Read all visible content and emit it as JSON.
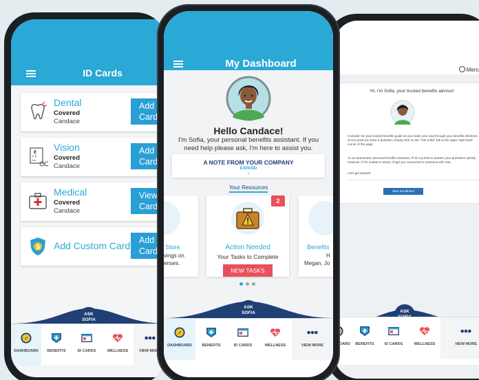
{
  "left_phone": {
    "title": "ID Cards",
    "cards": [
      {
        "title": "Dental",
        "status": "Covered",
        "name": "Candace",
        "button": [
          "Add",
          "Card"
        ],
        "icon": "tooth-icon"
      },
      {
        "title": "Vision",
        "status": "Covered",
        "name": "Candace",
        "button": [
          "Add",
          "Card"
        ],
        "icon": "eye-chart-icon"
      },
      {
        "title": "Medical",
        "status": "Covered",
        "name": "Candace",
        "button": [
          "View",
          "Card"
        ],
        "icon": "medical-kit-icon"
      },
      {
        "title": "Add Custom Card",
        "button": [
          "Add",
          "Card"
        ],
        "icon": "shield-dollar-icon"
      }
    ]
  },
  "center_phone": {
    "title": "My Dashboard",
    "greeting": "Hello Candace!",
    "intro": "I'm Sofia, your personal benefits assistant. If you need help please ask, I'm here to assist you.",
    "note_title": "A NOTE FROM YOUR COMPANY",
    "note_expand": "EXPAND",
    "resources_label": "Your Resources",
    "left_card": {
      "title": "Store",
      "line1": "vings on",
      "line2": "enses."
    },
    "main_card": {
      "badge": "2",
      "title": "Action Needed",
      "subtitle": "Your Tasks to Complete",
      "button": "NEW TASKS"
    },
    "right_card": {
      "title": "Benefits",
      "line1": "H",
      "line2": "Megan, Jo"
    }
  },
  "right_phone": {
    "menu": "Menu",
    "heading": "Hi, I'm Sofia, your trusted benefits advisor!",
    "para1": "Consider me your trusted benefits guide as you make your way through your benefits elections. If at any point you have a question, simply click on the \"Ask Sofia\" link in the upper right hand corner of the page.",
    "para2": "As an automated, personal benefits assistant, I'll do my best to answer your questions quickly. However, if I'm unable to assist, I'll get you connected to someone who can.",
    "para3": "Let's get started!",
    "button": "Start Enrollment"
  },
  "ask": {
    "line1": "ASK",
    "line2": "SOFIA"
  },
  "nav": [
    {
      "label": "DASHBOARD",
      "icon": "compass-icon"
    },
    {
      "label": "BENEFITS",
      "icon": "shield-plus-icon"
    },
    {
      "label": "ID CARDS",
      "icon": "id-card-icon"
    },
    {
      "label": "WELLNESS",
      "icon": "heart-pulse-icon"
    },
    {
      "label": "VIEW MORE",
      "icon": "more-dots-icon"
    }
  ],
  "colors": {
    "header": "#2aa8d6",
    "accent": "#2a9fd6",
    "navy": "#1f3f75",
    "alert": "#e8505b"
  }
}
